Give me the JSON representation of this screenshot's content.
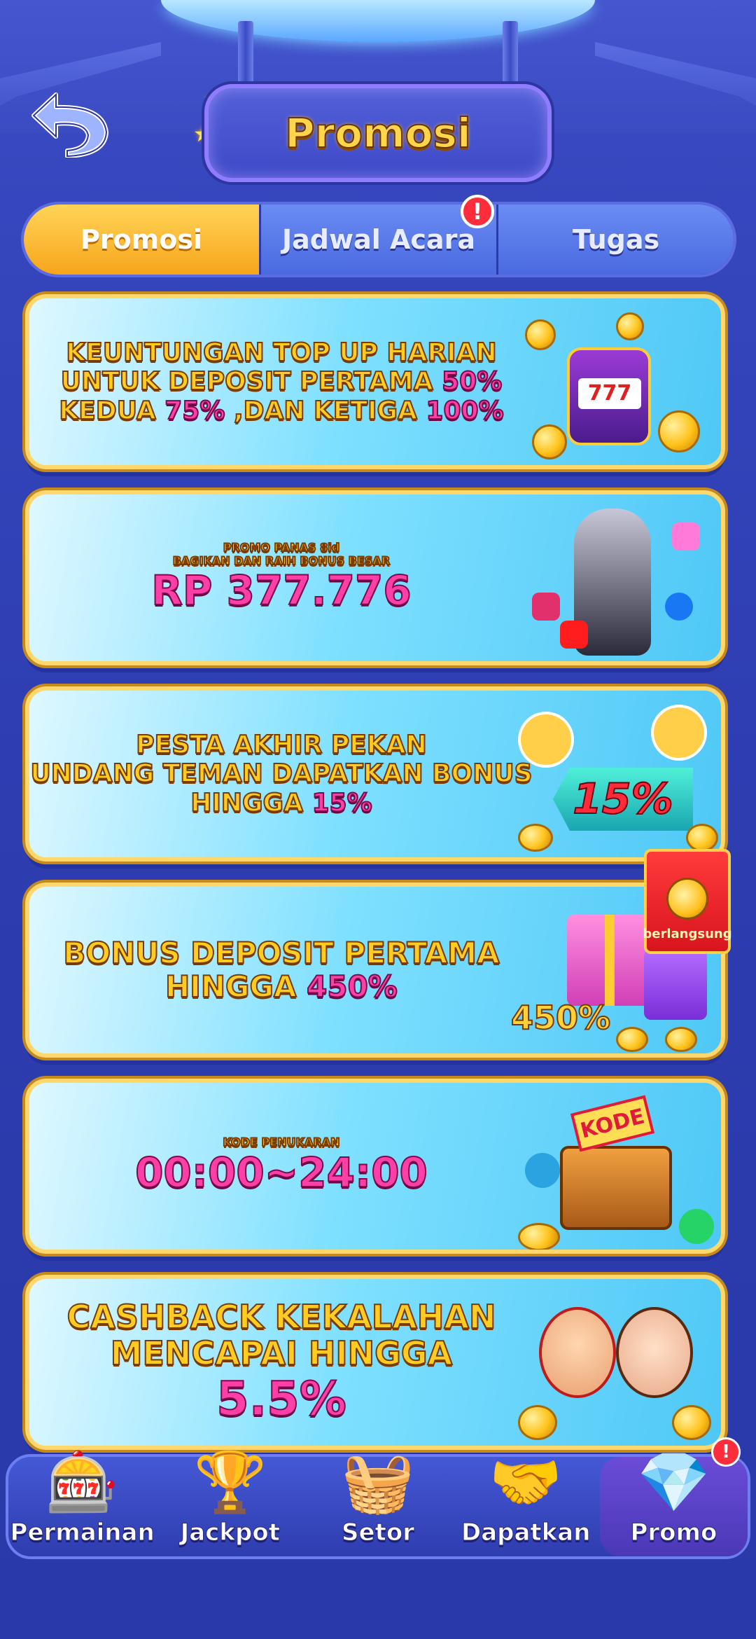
{
  "header": {
    "title": "Promosi",
    "back_icon": "undo-arrow-icon"
  },
  "tabs": {
    "items": [
      {
        "label": "Promosi",
        "active": true
      },
      {
        "label": "Jadwal Acara",
        "active": false,
        "badge": "!"
      },
      {
        "label": "Tugas",
        "active": false
      }
    ]
  },
  "promos": [
    {
      "lines": [
        [
          {
            "t": "KEUNTUNGAN TOP UP HARIAN",
            "c": "y"
          }
        ],
        [
          {
            "t": "UNTUK DEPOSIT PERTAMA ",
            "c": "y"
          },
          {
            "t": "50%",
            "c": "p"
          }
        ],
        [
          {
            "t": "KEDUA ",
            "c": "y"
          },
          {
            "t": "75%",
            "c": "p"
          },
          {
            "t": " ,DAN KETIGA ",
            "c": "y"
          },
          {
            "t": "100%",
            "c": "p"
          }
        ]
      ]
    },
    {
      "lines": [
        [
          {
            "t": "PROMO PANAS 8id",
            "c": "y"
          }
        ],
        [
          {
            "t": "BAGIKAN DAN RAIH BONUS BESAR",
            "c": "y"
          }
        ],
        [
          {
            "t": "RP 377.776",
            "c": "p"
          }
        ]
      ]
    },
    {
      "lines": [
        [
          {
            "t": "PESTA AKHIR PEKAN",
            "c": "y"
          }
        ],
        [
          {
            "t": "UNDANG TEMAN DAPATKAN BONUS",
            "c": "y"
          }
        ],
        [
          {
            "t": "HINGGA ",
            "c": "y"
          },
          {
            "t": "15%",
            "c": "p"
          }
        ]
      ],
      "art_text": "15%"
    },
    {
      "lines": [
        [
          {
            "t": "BONUS DEPOSIT PERTAMA",
            "c": "y"
          }
        ],
        [
          {
            "t": "HINGGA ",
            "c": "y"
          },
          {
            "t": "450%",
            "c": "p"
          }
        ]
      ],
      "art_text": "450%",
      "status_badge": "berlangsung"
    },
    {
      "lines": [
        [
          {
            "t": "KODE PENUKARAN",
            "c": "y"
          }
        ],
        [
          {
            "t": "00:00~24:00",
            "c": "p"
          }
        ]
      ],
      "art_text": "KODE"
    },
    {
      "lines": [
        [
          {
            "t": "CASHBACK KEKALAHAN",
            "c": "y"
          }
        ],
        [
          {
            "t": "MENCAPAI HINGGA",
            "c": "y"
          }
        ],
        [
          {
            "t": "5.5%",
            "c": "p"
          }
        ]
      ]
    }
  ],
  "bottom_nav": {
    "items": [
      {
        "label": "Permainan",
        "icon": "slot-machine-icon",
        "active": false
      },
      {
        "label": "Jackpot",
        "icon": "trophy-icon",
        "active": false
      },
      {
        "label": "Setor",
        "icon": "basket-icon",
        "active": false
      },
      {
        "label": "Dapatkan",
        "icon": "handshake-icon",
        "active": false
      },
      {
        "label": "Promo",
        "icon": "treasure-chest-icon",
        "active": true,
        "badge": "!"
      }
    ]
  },
  "colors": {
    "accent_yellow": "#ffcc22",
    "accent_pink": "#ff3fa8",
    "tab_active": "#f7a51c",
    "badge_red": "#ff2d3c"
  }
}
